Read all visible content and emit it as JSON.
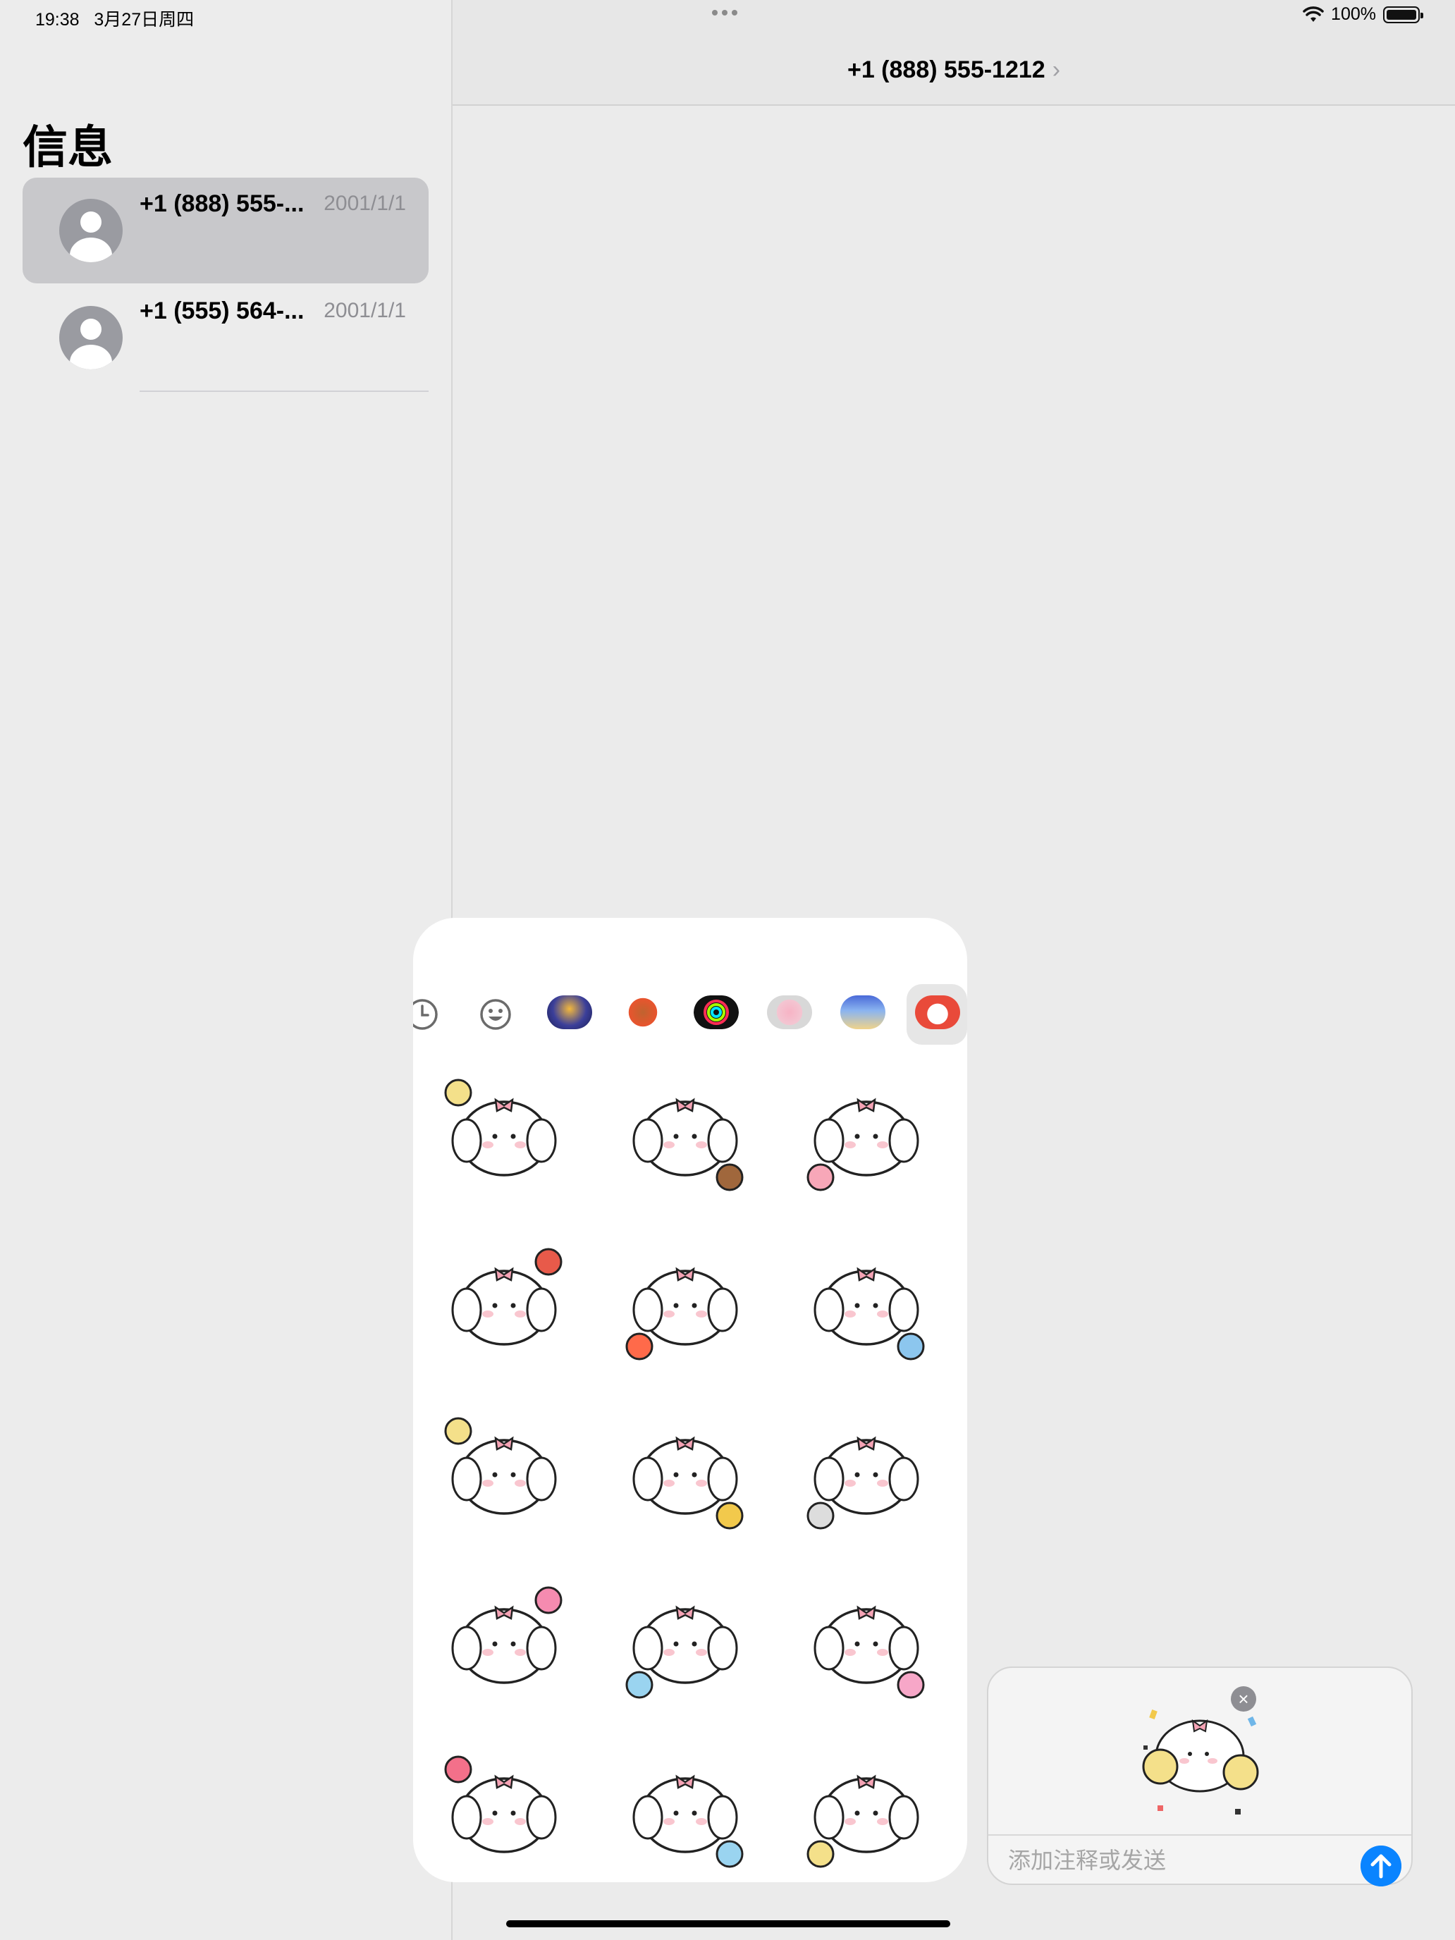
{
  "status_bar": {
    "time": "19:38",
    "date": "3月27日周四",
    "battery": "100%"
  },
  "sidebar": {
    "title": "信息",
    "conversations": [
      {
        "name": "+1 (888) 555-...",
        "date": "2001/1/1",
        "selected": true
      },
      {
        "name": "+1 (555) 564-...",
        "date": "2001/1/1",
        "selected": false
      }
    ]
  },
  "header": {
    "title": "+1 (888) 555-1212",
    "chevron": "›"
  },
  "sticker_panel": {
    "tabs": [
      "recent-clock-icon",
      "emoji-icon",
      "sticker-app-1",
      "memoji-icon",
      "activity-rings-icon",
      "sticker-app-pig",
      "sticker-app-whale",
      "sticker-app-puppy"
    ],
    "selected_tab": "sticker-app-puppy",
    "stickers": [
      "puppy-thumbs-up",
      "puppy-cookie",
      "puppy-writing",
      "puppy-map-apples",
      "puppy-fire-chick",
      "puppy-window-hearts",
      "puppy-with-chick",
      "puppy-sparkles",
      "puppy-shy",
      "puppy-flowers",
      "puppy-syringe",
      "puppy-balloons",
      "puppy-pencil",
      "puppy-surprised",
      "puppy-confetti"
    ]
  },
  "composer": {
    "placeholder": "添加注释或发送",
    "attached_sticker": "puppy-confetti",
    "remove_glyph": "×",
    "send_icon": "arrow-up-icon"
  },
  "colors": {
    "accent": "#0a84ff",
    "selected_row": "#c8c8cb"
  }
}
